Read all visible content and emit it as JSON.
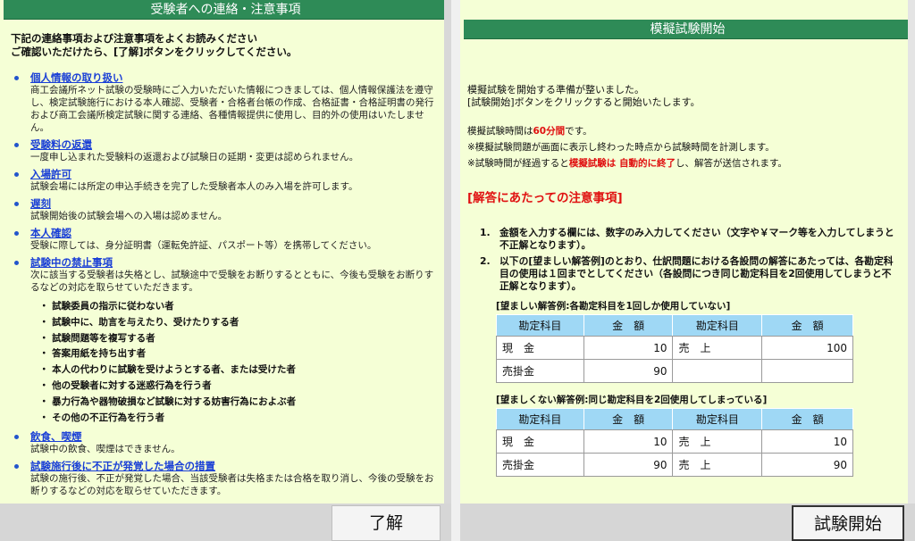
{
  "left": {
    "title": "受験者への連絡・注意事項",
    "intro_line1": "下記の連絡事項および注意事項をよくお読みください",
    "intro_line2": "ご確認いただけたら、[了解]ボタンをクリックしてください。",
    "sections": [
      {
        "heading": "個人情報の取り扱い",
        "body": "商工会議所ネット試験の受験時にご入力いただいた情報につきましては、個人情報保護法を遵守し、検定試験施行における本人確認、受験者・合格者台帳の作成、合格証書・合格証明書の発行および商工会議所検定試験に関する連絡、各種情報提供に使用し、目的外の使用はいたしません。"
      },
      {
        "heading": "受験料の返還",
        "body": "一度申し込まれた受験料の返還および試験日の延期・変更は認められません。"
      },
      {
        "heading": "入場許可",
        "body": "試験会場には所定の申込手続きを完了した受験者本人のみ入場を許可します。"
      },
      {
        "heading": "遅刻",
        "body": "試験開始後の試験会場への入場は認めません。"
      },
      {
        "heading": "本人確認",
        "body": "受験に際しては、身分証明書（運転免許証、パスポート等）を携帯してください。"
      },
      {
        "heading": "試験中の禁止事項",
        "body": "次に該当する受験者は失格とし、試験途中で受験をお断りするとともに、今後も受験をお断りするなどの対応を取らせていただきます。"
      },
      {
        "heading": "飲食、喫煙",
        "body": "試験中の飲食、喫煙はできません。"
      },
      {
        "heading": "試験施行後に不正が発覚した場合の措置",
        "body": "試験の施行後、不正が発覚した場合、当該受験者は失格または合格を取り消し、今後の受験をお断りするなどの対応を取らせていただきます。"
      }
    ],
    "prohibited": [
      "・ 試験委員の指示に従わない者",
      "・ 試験中に、助言を与えたり、受けたりする者",
      "・ 試験問題等を複写する者",
      "・ 答案用紙を持ち出す者",
      "・ 本人の代わりに試験を受けようとする者、または受けた者",
      "・ 他の受験者に対する迷惑行為を行う者",
      "・ 暴力行為や器物破損など試験に対する妨害行為におよぶ者",
      "・ その他の不正行為を行う者"
    ],
    "ack_button": "了解"
  },
  "right": {
    "title": "模擬試験開始",
    "ready_line1": "模擬試験を開始する準備が整いました。",
    "ready_line2": "[試験開始]ボタンをクリックすると開始いたします。",
    "time_prefix": "模擬試験時間は",
    "time_value": "60分間",
    "time_suffix": "です。",
    "timer_note": "※模擬試験問題が画面に表示し終わった時点から試験時間を計測します。",
    "auto_prefix": "※試験時間が経過すると",
    "auto_red": "模擬試験は 自動的に終了",
    "auto_suffix": "し、解答が送信されます。",
    "section_heading": "[解答にあたっての注意事項]",
    "rules": [
      {
        "num": "1.",
        "text": "金額を入力する欄には、数字のみ入力してください（文字や￥マーク等を入力してしまうと不正解となります）。"
      },
      {
        "num": "2.",
        "text": "以下の[望ましい解答例]のとおり、仕訳問題における各設問の解答にあたっては、各勘定科目の使用は１回までとしてください（各設問につき同じ勘定科目を2回使用してしまうと不正解となります）。"
      }
    ],
    "good_example": {
      "caption": "[望ましい解答例:各勘定科目を1回しか使用していない]",
      "headers": [
        "勘定科目",
        "金　額",
        "勘定科目",
        "金　額"
      ],
      "rows": [
        [
          "現　金",
          "10",
          "売　上",
          "100"
        ],
        [
          "売掛金",
          "90",
          "",
          ""
        ]
      ]
    },
    "bad_example": {
      "caption": "[望ましくない解答例:同じ勘定科目を2回使用してしまっている]",
      "headers": [
        "勘定科目",
        "金　額",
        "勘定科目",
        "金　額"
      ],
      "rows": [
        [
          "現　金",
          "10",
          "売　上",
          "10"
        ],
        [
          "売掛金",
          "90",
          "売　上",
          "90"
        ]
      ]
    },
    "start_button": "試験開始"
  }
}
